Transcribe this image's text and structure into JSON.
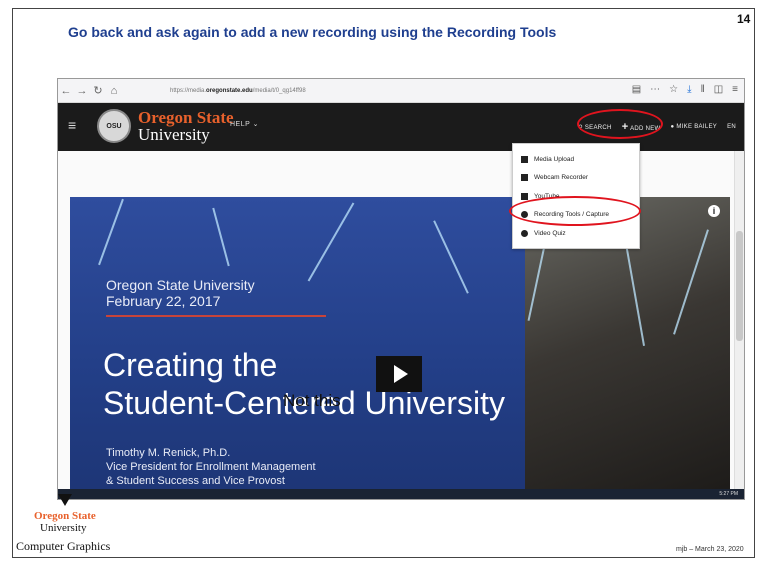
{
  "slide": {
    "title": "Go back and ask again to add a new recording using the Recording Tools",
    "number": "14",
    "footer_org_line1": "Oregon State",
    "footer_org_line2": "University",
    "footer_dept": "Computer Graphics",
    "footer_date": "mjb – March 23, 2020"
  },
  "browser": {
    "url_prefix": "https://media.",
    "url_domain": "oregonstate.edu",
    "url_path": "/media/t/0_qg14ff98"
  },
  "site": {
    "brand_line1": "Oregon State",
    "brand_line2": "University",
    "help_label": "HELP",
    "search_label": "SEARCH",
    "add_new_label": "ADD NEW",
    "user_label": "MIKE BAILEY",
    "lang_label": "EN"
  },
  "dropdown": {
    "items": [
      {
        "label": "Media Upload",
        "icon": "upload-icon"
      },
      {
        "label": "Webcam Recorder",
        "icon": "webcam-icon"
      },
      {
        "label": "YouTube",
        "icon": "youtube-icon"
      },
      {
        "label": "Recording Tools / Capture",
        "icon": "record-icon"
      },
      {
        "label": "Video Quiz",
        "icon": "quiz-icon"
      }
    ]
  },
  "video": {
    "subtitle_line1": "Oregon State University",
    "subtitle_line2": "February 22, 2017",
    "title_line1": "Creating the",
    "title_line2": "Student-Centered University",
    "presenter_line1": "Timothy M. Renick, Ph.D.",
    "presenter_line2": "Vice President for Enrollment Management",
    "presenter_line3": "& Student Success and Vice Provost",
    "overlay_note": "Not this",
    "taskbar_time": "5:27 PM"
  },
  "colors": {
    "title_blue": "#1f3f8f",
    "osu_orange": "#e8612c",
    "highlight_red": "#e0141e"
  }
}
